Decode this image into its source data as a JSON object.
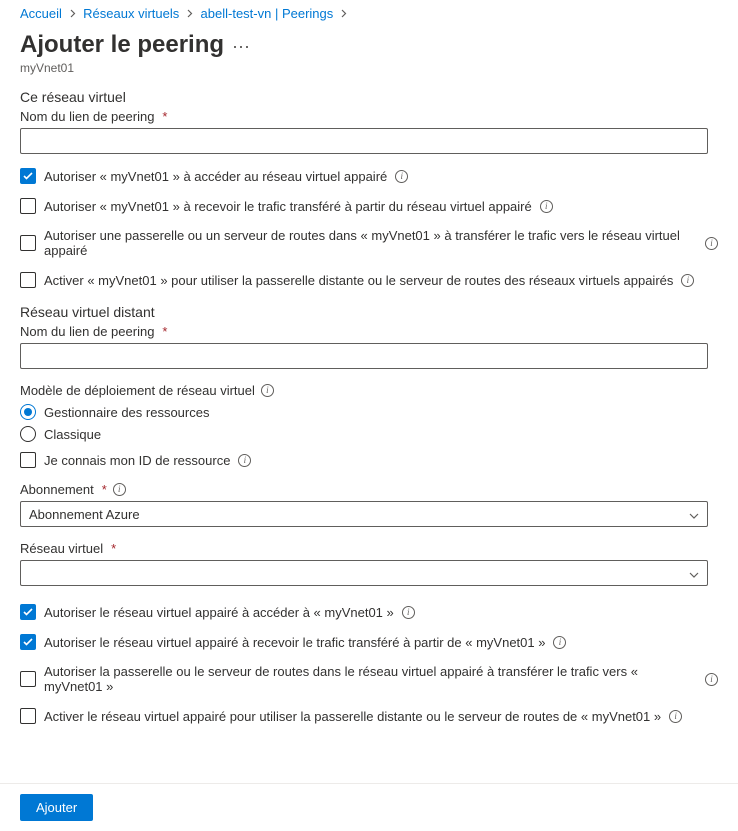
{
  "breadcrumb": {
    "home": "Accueil",
    "vnets": "Réseaux virtuels",
    "resource": "abell-test-vn | Peerings"
  },
  "title": "Ajouter le peering",
  "subtitle": "myVnet01",
  "this_vnet": {
    "header": "Ce réseau virtuel",
    "peering_name_label": "Nom du lien de peering",
    "peering_name_value": "",
    "cb_access": "Autoriser « myVnet01 » à accéder au réseau virtuel appairé",
    "cb_receive_forwarded": "Autoriser « myVnet01 » à recevoir le trafic transféré à partir du réseau virtuel appairé",
    "cb_gateway_transfer": "Autoriser une passerelle ou un serveur de routes dans « myVnet01 » à transférer le trafic vers le réseau virtuel appairé",
    "cb_use_remote_gateway": "Activer « myVnet01 » pour utiliser la passerelle distante ou le serveur de routes des réseaux virtuels appairés"
  },
  "remote_vnet": {
    "header": "Réseau virtuel distant",
    "peering_name_label": "Nom du lien de peering",
    "peering_name_value": "",
    "deployment_model_label": "Modèle de déploiement de réseau virtuel",
    "radio_rm": "Gestionnaire des ressources",
    "radio_classic": "Classique",
    "cb_know_id": "Je connais mon ID de ressource",
    "subscription_label": "Abonnement",
    "subscription_value": "Abonnement Azure",
    "vnet_label": "Réseau virtuel",
    "vnet_value": "",
    "cb_access": "Autoriser le réseau virtuel appairé à accéder à « myVnet01 »",
    "cb_receive_forwarded": "Autoriser le réseau virtuel appairé à recevoir le trafic transféré à partir de « myVnet01 »",
    "cb_gateway_transfer": "Autoriser la passerelle ou le serveur de routes dans le réseau virtuel appairé à transférer le trafic vers « myVnet01 »",
    "cb_use_remote_gateway": "Activer le réseau virtuel appairé pour utiliser la passerelle distante ou le serveur de routes de « myVnet01 »"
  },
  "footer": {
    "add": "Ajouter"
  }
}
